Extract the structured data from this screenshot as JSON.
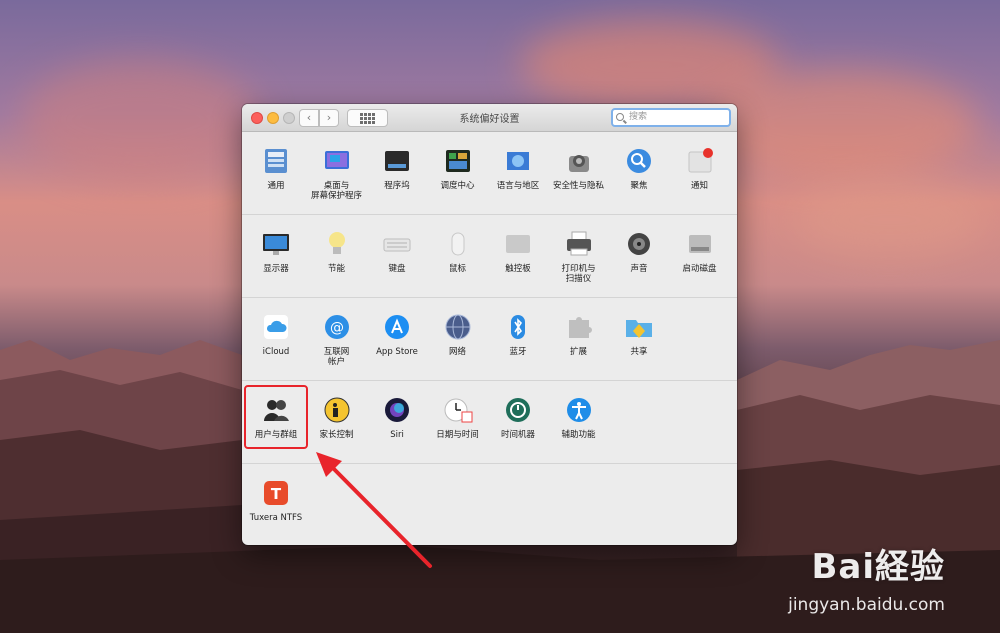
{
  "window": {
    "title": "系统偏好设置",
    "search_placeholder": "搜索",
    "nav_back": "‹",
    "nav_forward": "›"
  },
  "rows": [
    [
      {
        "label": "通用",
        "icon": "general-icon"
      },
      {
        "label": "桌面与\n屏幕保护程序",
        "icon": "desktop-screensaver-icon"
      },
      {
        "label": "程序坞",
        "icon": "dock-icon"
      },
      {
        "label": "调度中心",
        "icon": "mission-control-icon"
      },
      {
        "label": "语言与地区",
        "icon": "language-region-icon"
      },
      {
        "label": "安全性与隐私",
        "icon": "security-privacy-icon"
      },
      {
        "label": "聚焦",
        "icon": "spotlight-icon"
      },
      {
        "label": "通知",
        "icon": "notifications-icon"
      }
    ],
    [
      {
        "label": "显示器",
        "icon": "displays-icon"
      },
      {
        "label": "节能",
        "icon": "energy-saver-icon"
      },
      {
        "label": "键盘",
        "icon": "keyboard-icon"
      },
      {
        "label": "鼠标",
        "icon": "mouse-icon"
      },
      {
        "label": "触控板",
        "icon": "trackpad-icon"
      },
      {
        "label": "打印机与\n扫描仪",
        "icon": "printers-scanners-icon"
      },
      {
        "label": "声音",
        "icon": "sound-icon"
      },
      {
        "label": "启动磁盘",
        "icon": "startup-disk-icon"
      }
    ],
    [
      {
        "label": "iCloud",
        "icon": "icloud-icon"
      },
      {
        "label": "互联网\n帐户",
        "icon": "internet-accounts-icon"
      },
      {
        "label": "App Store",
        "icon": "app-store-icon"
      },
      {
        "label": "网络",
        "icon": "network-icon"
      },
      {
        "label": "蓝牙",
        "icon": "bluetooth-icon"
      },
      {
        "label": "扩展",
        "icon": "extensions-icon"
      },
      {
        "label": "共享",
        "icon": "sharing-icon"
      }
    ],
    [
      {
        "label": "用户与群组",
        "icon": "users-groups-icon",
        "highlighted": true
      },
      {
        "label": "家长控制",
        "icon": "parental-controls-icon"
      },
      {
        "label": "Siri",
        "icon": "siri-icon"
      },
      {
        "label": "日期与时间",
        "icon": "date-time-icon"
      },
      {
        "label": "时间机器",
        "icon": "time-machine-icon"
      },
      {
        "label": "辅助功能",
        "icon": "accessibility-icon"
      }
    ],
    [
      {
        "label": "Tuxera NTFS",
        "icon": "tuxera-ntfs-icon"
      }
    ]
  ],
  "watermark": {
    "brand": "Bai経验",
    "url": "jingyan.baidu.com"
  },
  "colors": {
    "highlight": "#e8242b",
    "arrow": "#e8242b"
  }
}
